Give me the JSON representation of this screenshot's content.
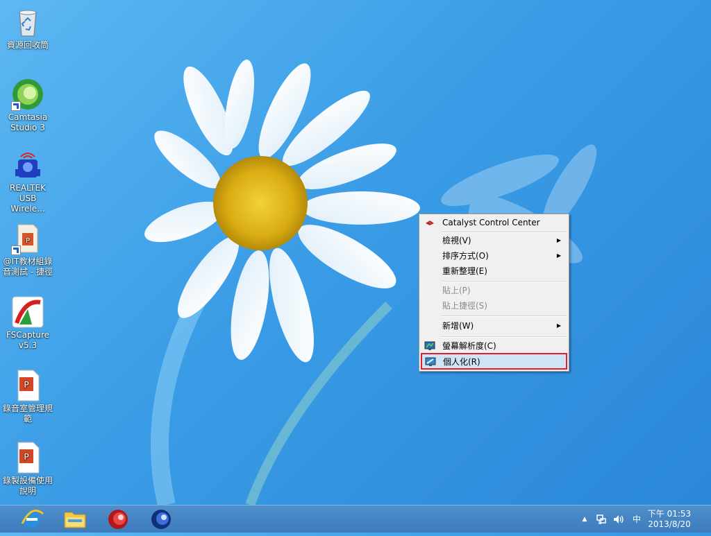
{
  "desktop_icons": [
    {
      "name": "recycle-bin",
      "icon": "recycle-bin-icon",
      "label": "資源回收筒"
    },
    {
      "name": "camtasia",
      "icon": "camtasia-icon",
      "label": "Camtasia Studio 3"
    },
    {
      "name": "realtek",
      "icon": "realtek-wireless-icon",
      "label": "REALTEK USB Wirele..."
    },
    {
      "name": "it-folder",
      "icon": "folder-shortcut-icon",
      "label": "@IT教材組錄音測試 - 捷徑"
    },
    {
      "name": "fscapture",
      "icon": "fscapture-icon",
      "label": "FSCapture v5.3"
    },
    {
      "name": "recording-rules",
      "icon": "powerpoint-file-icon",
      "label": "錄音室管理規範"
    },
    {
      "name": "recording-equipment",
      "icon": "powerpoint-file-icon",
      "label": "錄製設備使用說明"
    }
  ],
  "context_menu": {
    "catalyst": "Catalyst Control Center",
    "view": "檢視(V)",
    "sort": "排序方式(O)",
    "refresh": "重新整理(E)",
    "paste": "貼上(P)",
    "paste_shortcut": "貼上捷徑(S)",
    "new": "新增(W)",
    "resolution": "螢幕解析度(C)",
    "personalize": "個人化(R)"
  },
  "taskbar": {
    "pinned": [
      "internet-explorer-icon",
      "file-explorer-icon",
      "camtasia-recorder-icon",
      "camtasia-studio-icon"
    ],
    "tray": {
      "show_hidden": "▲",
      "ime": "中"
    },
    "clock": {
      "time": "下午 01:53",
      "date": "2013/8/20"
    }
  },
  "colors": {
    "highlight_border": "#e02030",
    "menu_selected": "#cfe5f6",
    "taskbar": "#3d7bbd"
  }
}
